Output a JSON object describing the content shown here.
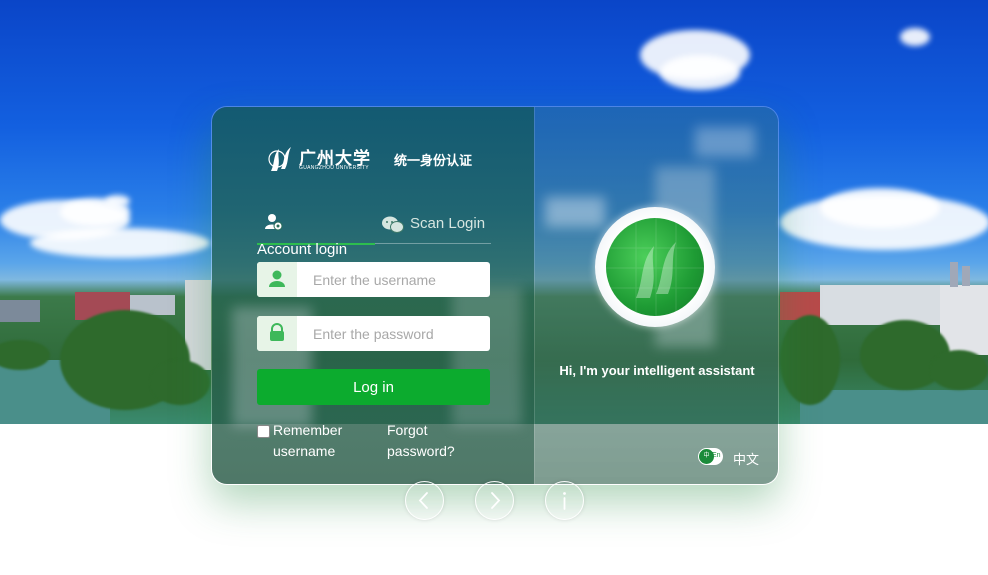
{
  "header": {
    "university_cn": "广州大学",
    "university_en": "GUANGZHOU UNIVERSITY",
    "system_title": "统一身份认证"
  },
  "tabs": {
    "account": {
      "label": "Account login",
      "icon": "user-icon"
    },
    "scan": {
      "label": "Scan Login",
      "icon": "wechat-icon"
    }
  },
  "form": {
    "username": {
      "value": "",
      "placeholder": "Enter the username",
      "icon": "user-icon"
    },
    "password": {
      "value": "",
      "placeholder": "Enter the password",
      "icon": "lock-icon"
    },
    "login_label": "Log in",
    "remember_label": "Remember username",
    "forgot_label": "Forgot password?"
  },
  "assistant": {
    "greeting": "Hi, I'm your intelligent assistant",
    "language_label": "中文"
  },
  "carousel_controls": [
    {
      "name": "prev",
      "icon": "chevron-left-icon"
    },
    {
      "name": "next",
      "icon": "chevron-right-icon"
    },
    {
      "name": "info",
      "icon": "info-icon"
    }
  ],
  "colors": {
    "primary_green": "#0cab2e",
    "active_tab_underline": "#2dbd4e",
    "sky": "#1360e0"
  }
}
